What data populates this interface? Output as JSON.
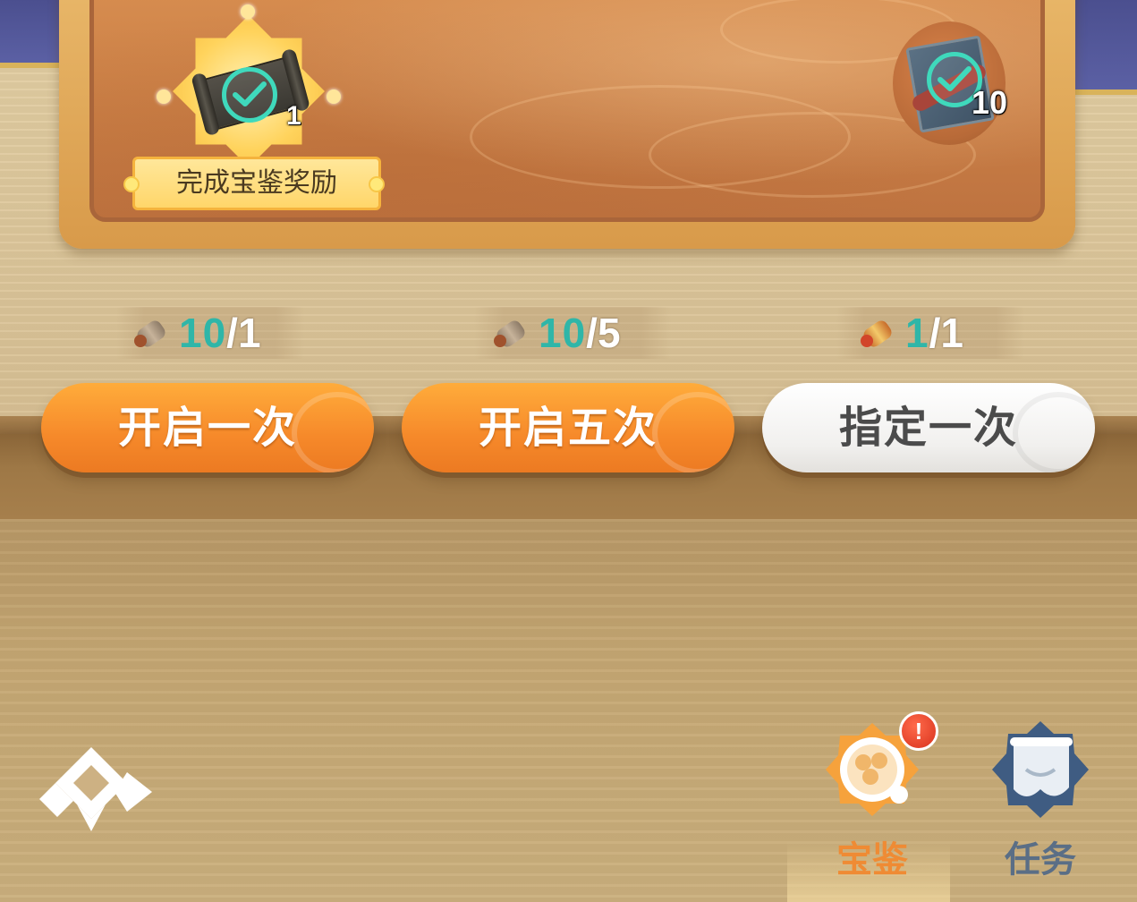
{
  "rewards": {
    "left": {
      "count": "1",
      "label": "完成宝鉴奖励",
      "claimed": true,
      "icon": "scroll-icon"
    },
    "right": {
      "count": "10",
      "claimed": true,
      "icon": "book-icon"
    }
  },
  "counters": [
    {
      "have": "10",
      "need": "/1",
      "icon": "ticket-icon"
    },
    {
      "have": "10",
      "need": "/5",
      "icon": "ticket-icon"
    },
    {
      "have": "1",
      "need": "/1",
      "icon": "golden-ticket-icon"
    }
  ],
  "buttons": {
    "open_once": "开启一次",
    "open_five": "开启五次",
    "specify_once": "指定一次"
  },
  "nav": {
    "tabs": [
      {
        "label": "宝鉴",
        "active": true,
        "badge": "!"
      },
      {
        "label": "任务",
        "active": false
      }
    ]
  },
  "colors": {
    "accent_orange": "#f6892a",
    "teal": "#2fb6a8",
    "active_tab_text": "#ef8b34",
    "inactive_tab_text": "#5a6e86"
  }
}
